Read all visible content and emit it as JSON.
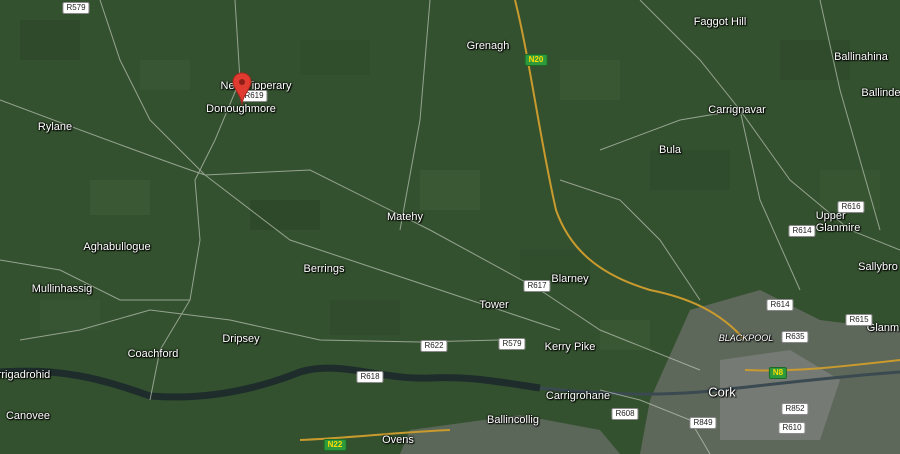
{
  "map": {
    "marker": {
      "name": "pin-icon",
      "color": "#e03b30"
    },
    "places": [
      {
        "id": "faggot-hill",
        "label": "Faggot Hill"
      },
      {
        "id": "grenagh",
        "label": "Grenagh"
      },
      {
        "id": "ballinahina",
        "label": "Ballinahina"
      },
      {
        "id": "ballindeasig",
        "label": "Ballindea"
      },
      {
        "id": "new-tipperary",
        "label": "New Tipperary"
      },
      {
        "id": "donoughmore",
        "label": "Donoughmore"
      },
      {
        "id": "rylane",
        "label": "Rylane"
      },
      {
        "id": "carrignavar",
        "label": "Carrignavar"
      },
      {
        "id": "bula",
        "label": "Bula"
      },
      {
        "id": "matehy",
        "label": "Matehy"
      },
      {
        "id": "upper-glanmire",
        "label": "Upper\nGlanmire"
      },
      {
        "id": "aghabullogue",
        "label": "Aghabullogue"
      },
      {
        "id": "berrings",
        "label": "Berrings"
      },
      {
        "id": "blarney",
        "label": "Blarney"
      },
      {
        "id": "sallybrook",
        "label": "Sallybro"
      },
      {
        "id": "mullinhassig",
        "label": "Mullinhassig"
      },
      {
        "id": "tower",
        "label": "Tower"
      },
      {
        "id": "glanmire",
        "label": "Glanm"
      },
      {
        "id": "dripsey",
        "label": "Dripsey"
      },
      {
        "id": "blackpool",
        "label": "BLACKPOOL"
      },
      {
        "id": "coachford",
        "label": "Coachford"
      },
      {
        "id": "kerry-pike",
        "label": "Kerry Pike"
      },
      {
        "id": "carrigadrohid",
        "label": "rrigadrohid"
      },
      {
        "id": "cork",
        "label": "Cork"
      },
      {
        "id": "carrigrohane",
        "label": "Carrigrohane"
      },
      {
        "id": "canovee",
        "label": "Canovee"
      },
      {
        "id": "ballincollig",
        "label": "Ballincollig"
      },
      {
        "id": "ovens",
        "label": "Ovens"
      }
    ],
    "shields": [
      {
        "id": "r579-top",
        "label": "R579"
      },
      {
        "id": "n20",
        "label": "N20"
      },
      {
        "id": "r619",
        "label": "R619"
      },
      {
        "id": "r616",
        "label": "R616"
      },
      {
        "id": "r614-a",
        "label": "R614"
      },
      {
        "id": "r617",
        "label": "R617"
      },
      {
        "id": "r614-b",
        "label": "R614"
      },
      {
        "id": "r615",
        "label": "R615"
      },
      {
        "id": "r635",
        "label": "R635"
      },
      {
        "id": "r622",
        "label": "R622"
      },
      {
        "id": "r579-mid",
        "label": "R579"
      },
      {
        "id": "r618",
        "label": "R618"
      },
      {
        "id": "n8",
        "label": "N8"
      },
      {
        "id": "r608",
        "label": "R608"
      },
      {
        "id": "r852",
        "label": "R852"
      },
      {
        "id": "r849",
        "label": "R849"
      },
      {
        "id": "r610",
        "label": "R610"
      },
      {
        "id": "n22",
        "label": "N22"
      }
    ]
  }
}
